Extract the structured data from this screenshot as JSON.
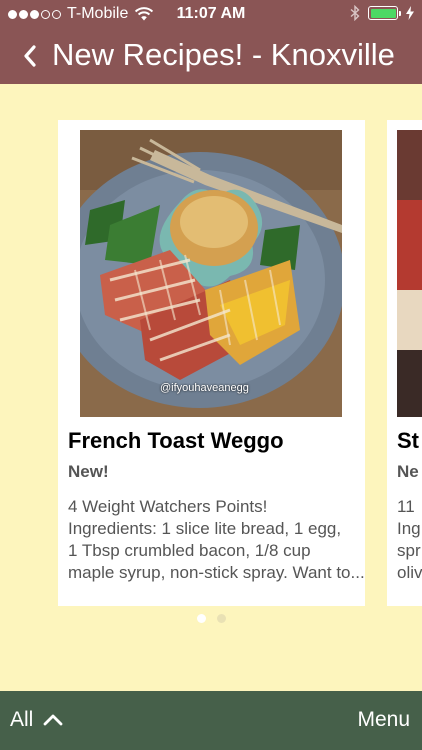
{
  "status_bar": {
    "carrier": "T-Mobile",
    "time": "11:07 AM",
    "signal_bars_filled": 3,
    "signal_bars_total": 5,
    "battery_level": 1.0,
    "colors": {
      "battery": "#4cd964"
    }
  },
  "nav": {
    "back_icon": "chevron-left-icon",
    "title": "New Recipes! - Knoxville"
  },
  "recipes": [
    {
      "photo_caption": "@ifyouhaveanegg",
      "title": "French Toast Weggo",
      "badge": "New!",
      "description_lines": [
        "4 Weight Watchers Points!",
        "Ingredients: 1 slice lite bread, 1 egg,",
        "1 Tbsp crumbled bacon, 1/8 cup",
        "maple syrup, non-stick spray. Want to..."
      ]
    },
    {
      "title": "St",
      "badge": "Ne",
      "description_lines": [
        "11",
        "Ing",
        "spr",
        "oliv"
      ]
    }
  ],
  "pager": {
    "count": 2,
    "active_index": 0
  },
  "bottom_bar": {
    "filter_label": "All",
    "filter_icon": "chevron-up-icon",
    "menu_label": "Menu"
  },
  "colors": {
    "nav_bar": "#8a5555",
    "background": "#fdf5bd",
    "bottom_bar": "#46604a",
    "card": "#ffffff"
  }
}
